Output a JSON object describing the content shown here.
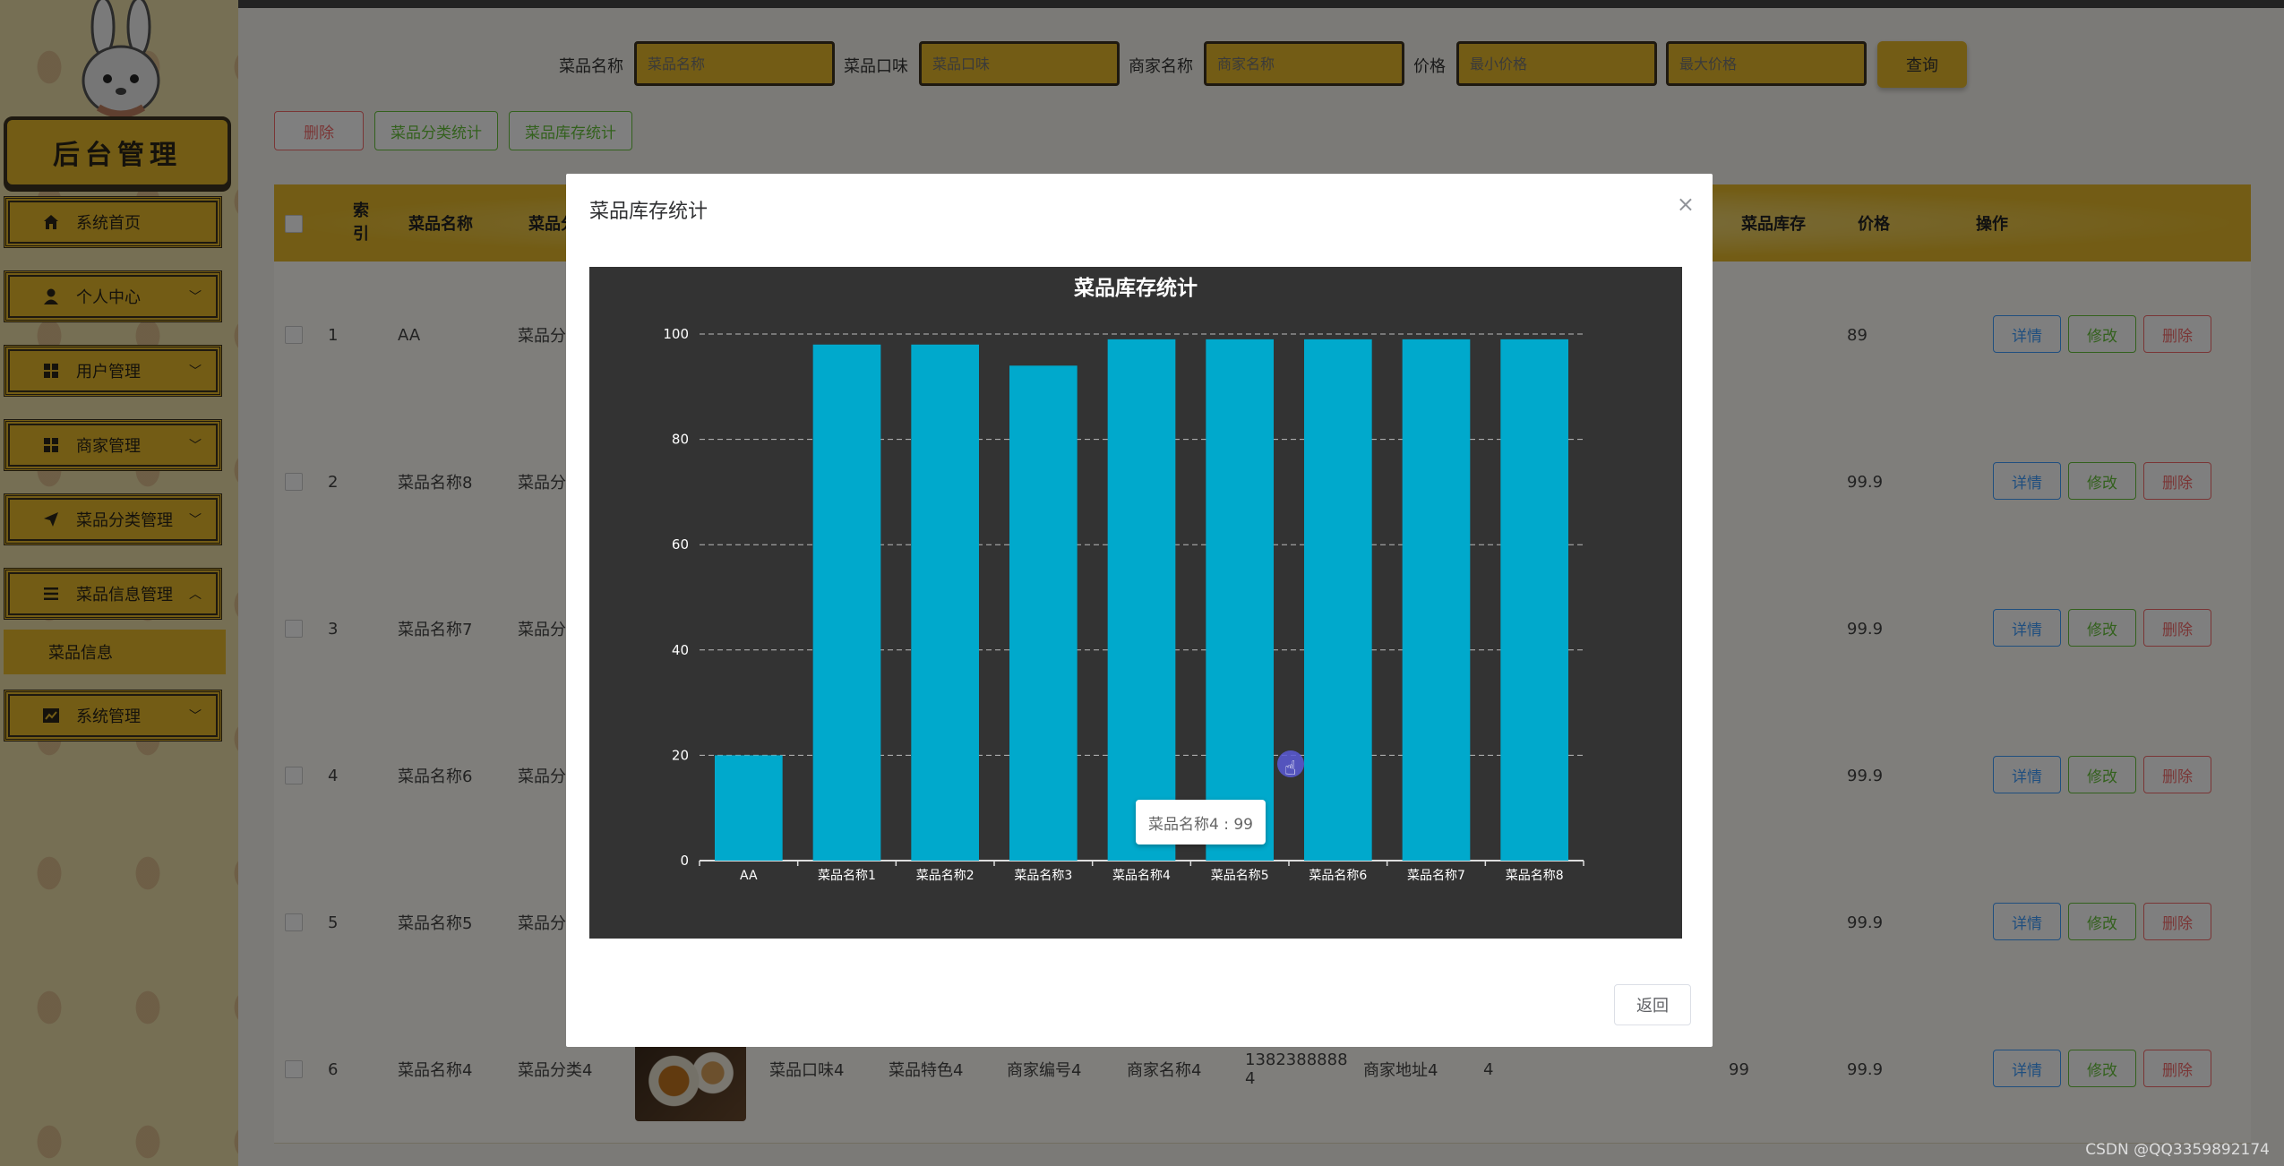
{
  "sidebar": {
    "logo_text": "后台管理",
    "menu": [
      {
        "label": "系统首页",
        "icon": "home-icon",
        "has_chevron": false
      },
      {
        "label": "个人中心",
        "icon": "user-icon",
        "has_chevron": true
      },
      {
        "label": "用户管理",
        "icon": "grid-icon",
        "has_chevron": true
      },
      {
        "label": "商家管理",
        "icon": "grid-icon",
        "has_chevron": true
      },
      {
        "label": "菜品分类管理",
        "icon": "send-icon",
        "has_chevron": true
      },
      {
        "label": "菜品信息管理",
        "icon": "list-icon",
        "has_chevron": true
      },
      {
        "label": "系统管理",
        "icon": "chart-icon",
        "has_chevron": true
      }
    ],
    "submenu": {
      "label": "菜品信息"
    }
  },
  "search": {
    "dish_name_label": "菜品名称",
    "dish_name_placeholder": "菜品名称",
    "flavor_label": "菜品口味",
    "flavor_placeholder": "菜品口味",
    "merchant_label": "商家名称",
    "merchant_placeholder": "商家名称",
    "price_label": "价格",
    "price_min_placeholder": "最小价格",
    "price_max_placeholder": "最大价格",
    "query_label": "查询"
  },
  "actions": {
    "delete_label": "删除",
    "category_stats_label": "菜品分类统计",
    "stock_stats_label": "菜品库存统计"
  },
  "table": {
    "headers": {
      "index": "索引",
      "dish_name": "菜品名称",
      "dish_category": "菜品分类",
      "stock": "菜品库存",
      "price": "价格",
      "operation": "操作"
    },
    "rows": [
      {
        "index": "1",
        "name": "AA",
        "category": "菜品分",
        "price": "89"
      },
      {
        "index": "2",
        "name": "菜品名称8",
        "category": "菜品分",
        "price": "99.9"
      },
      {
        "index": "3",
        "name": "菜品名称7",
        "category": "菜品分",
        "price": "99.9"
      },
      {
        "index": "4",
        "name": "菜品名称6",
        "category": "菜品分",
        "price": "99.9"
      },
      {
        "index": "5",
        "name": "菜品名称5",
        "category": "菜品分",
        "price": "99.9"
      },
      {
        "index": "6",
        "name": "菜品名称4",
        "category": "菜品分类4",
        "price": "99.9",
        "flavor": "菜品口味4",
        "feature": "菜品特色4",
        "merchant_no": "商家编号4",
        "merchant_name": "商家名称4",
        "phone_line1": "1382388888",
        "phone_line2": "4",
        "address": "商家地址4",
        "col_a": "4",
        "stock": "99"
      }
    ],
    "op_detail": "详情",
    "op_edit": "修改",
    "op_delete": "删除"
  },
  "modal": {
    "title": "菜品库存统计",
    "back_label": "返回",
    "tooltip": "菜品名称4 : 99"
  },
  "chart_data": {
    "type": "bar",
    "title": "菜品库存统计",
    "categories": [
      "AA",
      "菜品名称1",
      "菜品名称2",
      "菜品名称3",
      "菜品名称4",
      "菜品名称5",
      "菜品名称6",
      "菜品名称7",
      "菜品名称8"
    ],
    "values": [
      20,
      98,
      98,
      94,
      99,
      99,
      99,
      99,
      99
    ],
    "ylim": [
      0,
      100
    ],
    "yticks": [
      0,
      20,
      40,
      60,
      80,
      100
    ],
    "grid": true,
    "bar_color": "#00a9cc",
    "background": "#333333"
  },
  "watermark": "CSDN @QQ3359892174"
}
